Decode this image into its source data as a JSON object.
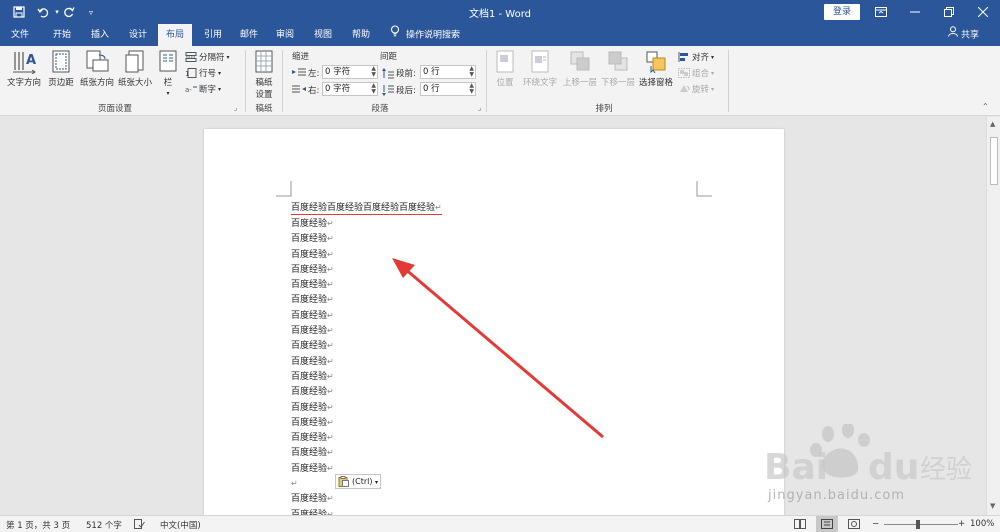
{
  "titlebar": {
    "title": "文档1 - Word",
    "login": "登录"
  },
  "tabs": [
    "文件",
    "开始",
    "插入",
    "设计",
    "布局",
    "引用",
    "邮件",
    "审阅",
    "视图",
    "帮助"
  ],
  "active_tab": "布局",
  "tell_me": "操作说明搜索",
  "share": "共享",
  "ribbon": {
    "page_setup": {
      "text_direction": "文字方向",
      "margins": "页边距",
      "orientation": "纸张方向",
      "size": "纸张大小",
      "columns": "栏",
      "breaks": "分隔符",
      "line_numbers": "行号",
      "hyphenation": "断字",
      "label": "页面设置"
    },
    "draft": {
      "setup": "稿纸\n设置",
      "setup_line1": "稿纸",
      "setup_line2": "设置",
      "label": "稿纸"
    },
    "paragraph": {
      "indent_title": "缩进",
      "spacing_title": "间距",
      "left_label": "左:",
      "right_label": "右:",
      "left_value": "0 字符",
      "right_value": "0 字符",
      "before_label": "段前:",
      "after_label": "段后:",
      "before_value": "0 行",
      "after_value": "0 行",
      "label": "段落"
    },
    "arrange": {
      "position": "位置",
      "wrap_text": "环绕文字",
      "bring_forward": "上移一层",
      "send_backward": "下移一层",
      "selection_pane": "选择窗格",
      "align": "对齐",
      "group": "组合",
      "rotate": "旋转",
      "label": "排列"
    }
  },
  "document": {
    "first_line": "百度经验百度经验百度经验百度经验",
    "lines_a": [
      "百度经验",
      "百度经验",
      "百度经验",
      "百度经验",
      "百度经验",
      "百度经验",
      "百度经验",
      "百度经验",
      "百度经验",
      "百度经验",
      "百度经验",
      "百度经验",
      "百度经验",
      "百度经验",
      "百度经验",
      "百度经验",
      "百度经验"
    ],
    "lines_b": [
      "百度经验",
      "百度经验"
    ],
    "paste_options": "(Ctrl)"
  },
  "statusbar": {
    "page": "第 1 页，共 3 页",
    "words": "512 个字",
    "language": "中文(中国)",
    "zoom": "100%"
  },
  "watermark": {
    "url": "jingyan.baidu.com"
  },
  "colors": {
    "brand": "#2b579a",
    "arrow": "#e53935"
  }
}
